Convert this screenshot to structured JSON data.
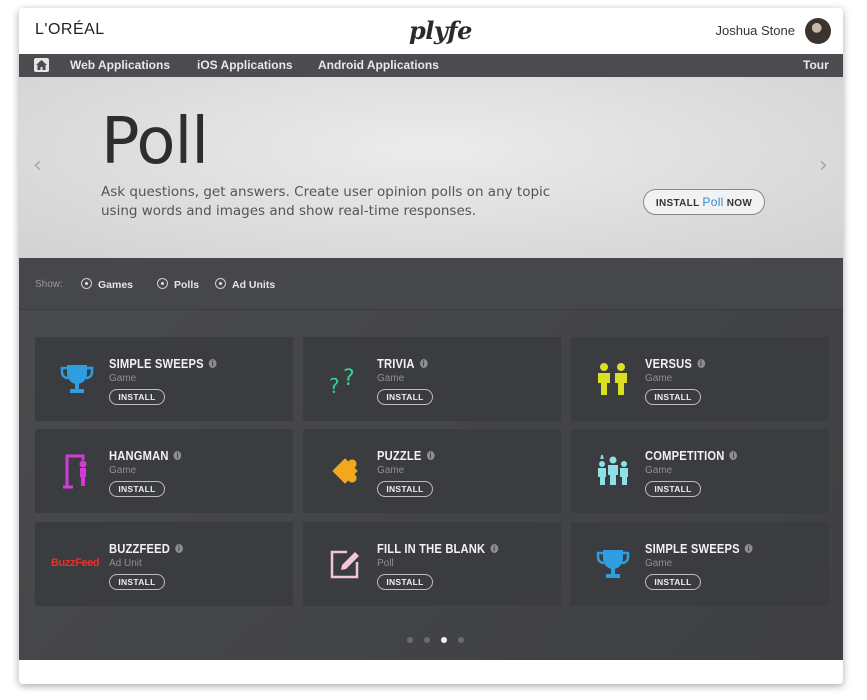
{
  "header": {
    "brand": "L'ORÉAL",
    "logo": "plyfe",
    "user_name": "Joshua Stone"
  },
  "nav": {
    "items": [
      "Web Applications",
      "iOS Applications",
      "Android Applications"
    ],
    "tour": "Tour"
  },
  "hero": {
    "title": "Poll",
    "description": "Ask questions, get answers. Create user opinion polls on any topic using words and images and show real-time responses.",
    "install_prefix": "INSTALL",
    "install_highlight": "Poll",
    "install_suffix": "NOW"
  },
  "filter": {
    "show_label": "Show:",
    "options": [
      "Games",
      "Polls",
      "Ad Units"
    ]
  },
  "cards": [
    {
      "title": "SIMPLE SWEEPS",
      "category": "Game",
      "button": "INSTALL",
      "icon": "trophy-icon",
      "color": "#2e9ee0"
    },
    {
      "title": "TRIVIA",
      "category": "Game",
      "button": "INSTALL",
      "icon": "question-marks-icon",
      "color": "#35d08e"
    },
    {
      "title": "VERSUS",
      "category": "Game",
      "button": "INSTALL",
      "icon": "versus-people-icon",
      "color": "#d9e021"
    },
    {
      "title": "HANGMAN",
      "category": "Game",
      "button": "INSTALL",
      "icon": "hangman-icon",
      "color": "#d23bd8"
    },
    {
      "title": "PUZZLE",
      "category": "Game",
      "button": "INSTALL",
      "icon": "puzzle-piece-icon",
      "color": "#f2a81d"
    },
    {
      "title": "COMPETITION",
      "category": "Game",
      "button": "INSTALL",
      "icon": "competition-people-icon",
      "color": "#8ee0e8"
    },
    {
      "title": "BUZZFEED",
      "category": "Ad Unit",
      "button": "INSTALL",
      "icon": "buzzfeed-logo-icon",
      "color": "#e8322a",
      "icon_text": "BuzzFeed"
    },
    {
      "title": "FILL IN THE BLANK",
      "category": "Poll",
      "button": "INSTALL",
      "icon": "edit-pencil-icon",
      "color": "#f4c6d4"
    },
    {
      "title": "SIMPLE SWEEPS",
      "category": "Game",
      "button": "INSTALL",
      "icon": "trophy-icon",
      "color": "#2e9ee0"
    }
  ],
  "pagination": {
    "total": 4,
    "active": 3
  }
}
